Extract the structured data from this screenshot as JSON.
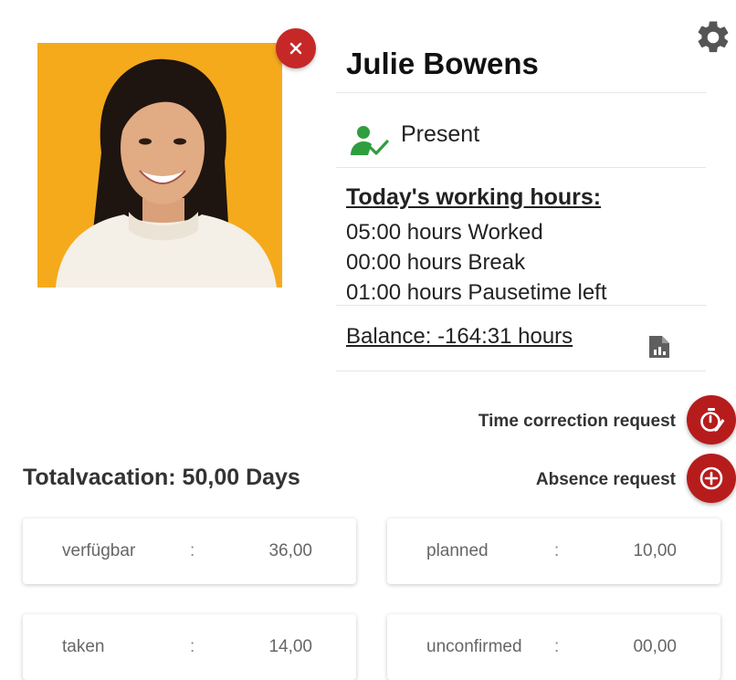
{
  "profile": {
    "name": "Julie Bowens",
    "status": "Present"
  },
  "working_hours": {
    "title": "Today's working hours:",
    "worked": "05:00 hours Worked",
    "break": "00:00 hours Break",
    "pause_left": "01:00 hours Pausetime left"
  },
  "balance": "Balance: -164:31 hours",
  "actions": {
    "time_correction": "Time correction request",
    "absence": "Absence request"
  },
  "vacation": {
    "total": "Totalvacation: 50,00 Days",
    "cards": [
      {
        "label": "verfügbar",
        "separator": ":",
        "value": "36,00"
      },
      {
        "label": "planned",
        "separator": ":",
        "value": "10,00"
      },
      {
        "label": "taken",
        "separator": ":",
        "value": "14,00"
      },
      {
        "label": "unconfirmed",
        "separator": ":",
        "value": "00,00"
      }
    ]
  },
  "icons": {
    "close": "close-icon",
    "settings": "gear-icon",
    "status": "user-check-icon",
    "report": "report-file-icon",
    "time_correction": "timer-edit-icon",
    "absence": "add-circle-icon"
  },
  "colors": {
    "accent_red": "#b71c1c",
    "status_green": "#2e9e3e",
    "photo_background": "#f5aa1c"
  }
}
